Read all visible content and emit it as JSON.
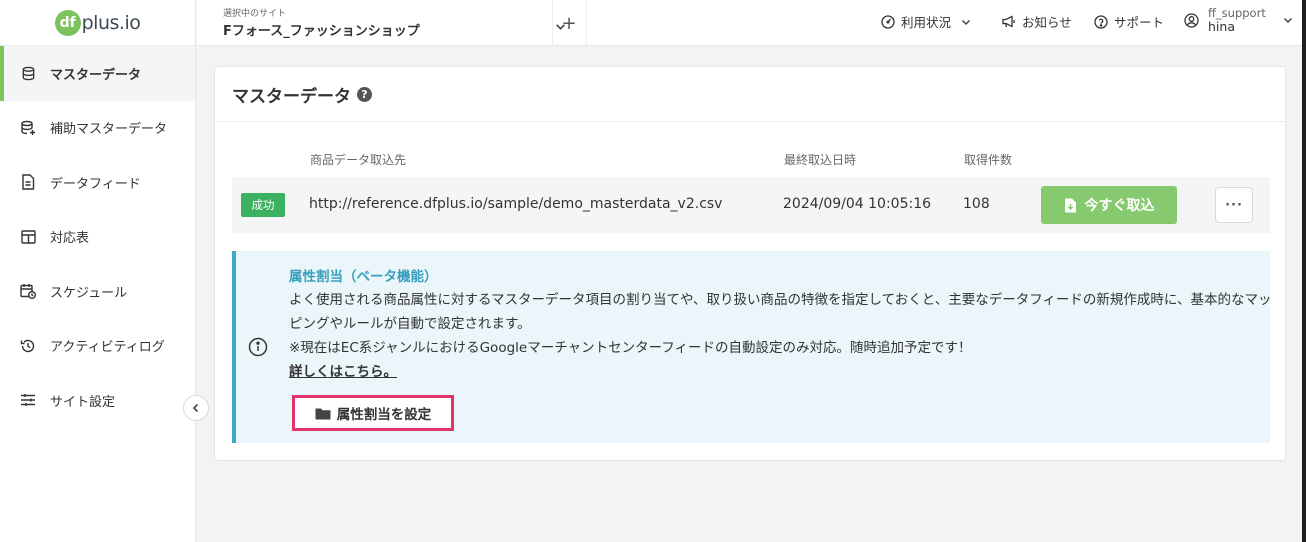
{
  "logo": {
    "badge": "df",
    "text": "plus.io"
  },
  "sidebar": {
    "items": [
      {
        "label": "マスターデータ",
        "icon": "database-icon",
        "active": true
      },
      {
        "label": "補助マスターデータ",
        "icon": "database-plus-icon"
      },
      {
        "label": "データフィード",
        "icon": "file-icon"
      },
      {
        "label": "対応表",
        "icon": "table-icon"
      },
      {
        "label": "スケジュール",
        "icon": "calendar-icon"
      },
      {
        "label": "アクティビティログ",
        "icon": "history-icon"
      },
      {
        "label": "サイト設定",
        "icon": "sliders-icon"
      }
    ]
  },
  "header": {
    "site_caption": "選択中のサイト",
    "site_name": "Fフォース_ファッションショップ",
    "plus": "+",
    "usage": "利用状況",
    "news": "お知らせ",
    "support": "サポート",
    "user_name": "ff_support",
    "user_sub": "hina"
  },
  "card": {
    "title": "マスターデータ",
    "help": "?",
    "columns": {
      "source": "商品データ取込先",
      "last_import": "最終取込日時",
      "count": "取得件数"
    },
    "row": {
      "status": "成功",
      "url": "http://reference.dfplus.io/sample/demo_masterdata_v2.csv",
      "date": "2024/09/04 10:05:16",
      "count": "108",
      "import_label": "今すぐ取込",
      "more": "···"
    },
    "info": {
      "title": "属性割当（ベータ機能）",
      "text": "よく使用される商品属性に対するマスターデータ項目の割り当てや、取り扱い商品の特徴を指定しておくと、主要なデータフィードの新規作成時に、基本的なマッピングやルールが自動で設定されます。",
      "note": "※現在はEC系ジャンルにおけるGoogleマーチャントセンターフィードの自動設定のみ対応。随時追加予定です！",
      "link": "詳しくはこちら。",
      "button": "属性割当を設定"
    }
  },
  "colors": {
    "accent": "#7cc35d",
    "success": "#3cb15f",
    "info": "#3aa9c9",
    "highlight": "#e2336b"
  }
}
